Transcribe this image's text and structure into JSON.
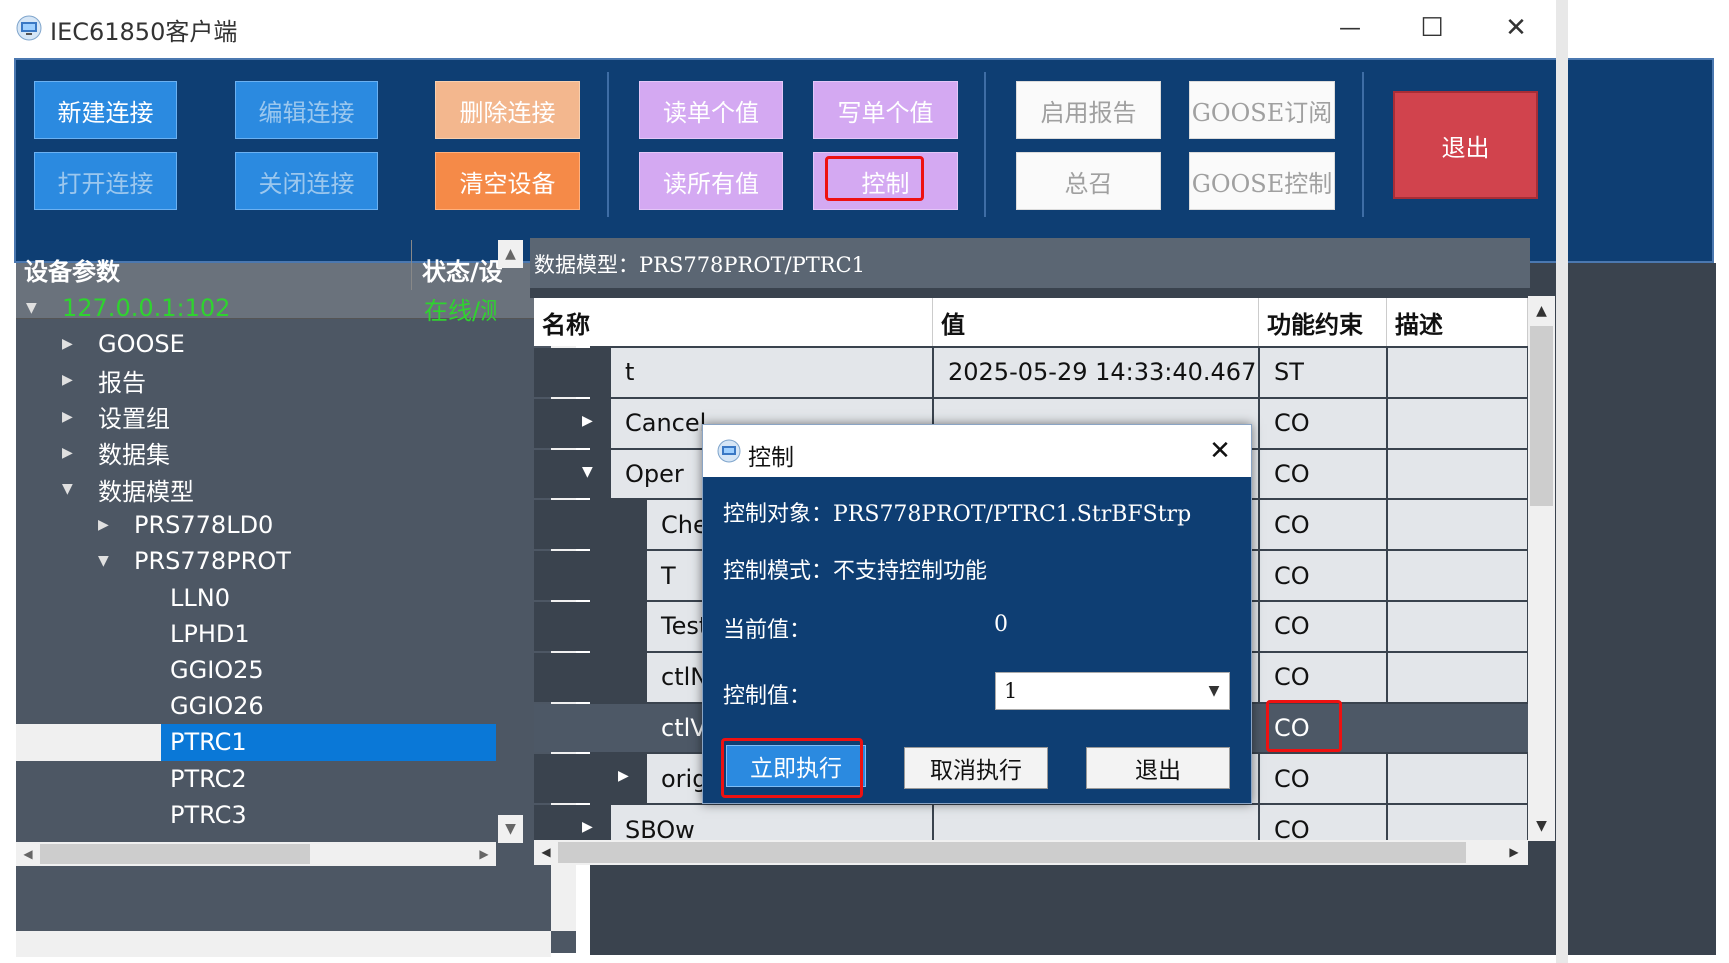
{
  "window": {
    "title": "IEC61850客户端",
    "minimize_glyph": "—",
    "maximize_glyph": "☐",
    "close_glyph": "✕"
  },
  "toolbar": {
    "new_connection": "新建连接",
    "edit_connection": "编辑连接",
    "delete_connection": "删除连接",
    "open_connection": "打开连接",
    "close_connection": "关闭连接",
    "clear_device": "清空设备",
    "read_single": "读单个值",
    "write_single": "写单个值",
    "read_all": "读所有值",
    "control": "控制",
    "enable_report": "启用报告",
    "goose_subscribe": "GOOSE订阅",
    "general_interrogation": "总召",
    "goose_control": "GOOSE控制",
    "exit": "退出"
  },
  "left_panel": {
    "col_device_params": "设备参数",
    "col_status": "状态/设",
    "tree": [
      {
        "label": "127.0.0.1:102",
        "status": "在线/测",
        "arrow": "▼",
        "level": 0
      },
      {
        "label": "GOOSE",
        "arrow": "▶",
        "level": 1
      },
      {
        "label": "报告",
        "arrow": "▶",
        "level": 1
      },
      {
        "label": "设置组",
        "arrow": "▶",
        "level": 1
      },
      {
        "label": "数据集",
        "arrow": "▶",
        "level": 1
      },
      {
        "label": "数据模型",
        "arrow": "▼",
        "level": 1
      },
      {
        "label": "PRS778LD0",
        "arrow": "▶",
        "level": 2
      },
      {
        "label": "PRS778PROT",
        "arrow": "▼",
        "level": 2
      },
      {
        "label": "LLN0",
        "arrow": "",
        "level": 3
      },
      {
        "label": "LPHD1",
        "arrow": "",
        "level": 3
      },
      {
        "label": "GGIO25",
        "arrow": "",
        "level": 3
      },
      {
        "label": "GGIO26",
        "arrow": "",
        "level": 3
      },
      {
        "label": "PTRC1",
        "arrow": "",
        "level": 3
      },
      {
        "label": "PTRC2",
        "arrow": "",
        "level": 3
      },
      {
        "label": "PTRC3",
        "arrow": "",
        "level": 3
      }
    ]
  },
  "right_panel": {
    "caption": "数据模型：PRS778PROT/PTRC1",
    "columns": [
      "名称",
      "值",
      "功能约束",
      "描述"
    ],
    "rows": [
      {
        "name": "t",
        "value": "2025-05-29 14:33:40.467",
        "fc": "ST",
        "desc": ""
      },
      {
        "name": "Cancel",
        "value": "",
        "fc": "CO",
        "desc": ""
      },
      {
        "name": "Oper",
        "value": "",
        "fc": "CO",
        "desc": ""
      },
      {
        "name": "Che",
        "value": "",
        "fc": "CO",
        "desc": ""
      },
      {
        "name": "T",
        "value": "",
        "fc": "CO",
        "desc": ""
      },
      {
        "name": "Test",
        "value": "",
        "fc": "CO",
        "desc": ""
      },
      {
        "name": "ctlN",
        "value": "",
        "fc": "CO",
        "desc": ""
      },
      {
        "name": "ctlV",
        "value": "",
        "fc": "CO",
        "desc": ""
      },
      {
        "name": "orig",
        "value": "",
        "fc": "CO",
        "desc": ""
      },
      {
        "name": "SBOw",
        "value": "",
        "fc": "CO",
        "desc": ""
      }
    ],
    "row_arrows": [
      "",
      "▶",
      "▼",
      "",
      "",
      "",
      "",
      "",
      "▶",
      "▶"
    ]
  },
  "dialog": {
    "title": "控制",
    "close_glyph": "✕",
    "control_object_label": "控制对象：PRS778PROT/PTRC1.StrBFStrp",
    "control_mode_label": "控制模式：不支持控制功能",
    "current_value_label": "当前值：",
    "current_value": "0",
    "control_value_label": "控制值：",
    "control_value": "1",
    "execute_now": "立即执行",
    "cancel_execute": "取消执行",
    "exit": "退出"
  },
  "scroll": {
    "up": "▲",
    "down": "▼",
    "left": "◀",
    "right": "▶"
  },
  "colors": {
    "toolbar_bg": "#0e3e73",
    "highlight_red": "#ee1111",
    "selected_tree": "#0a78d7"
  }
}
